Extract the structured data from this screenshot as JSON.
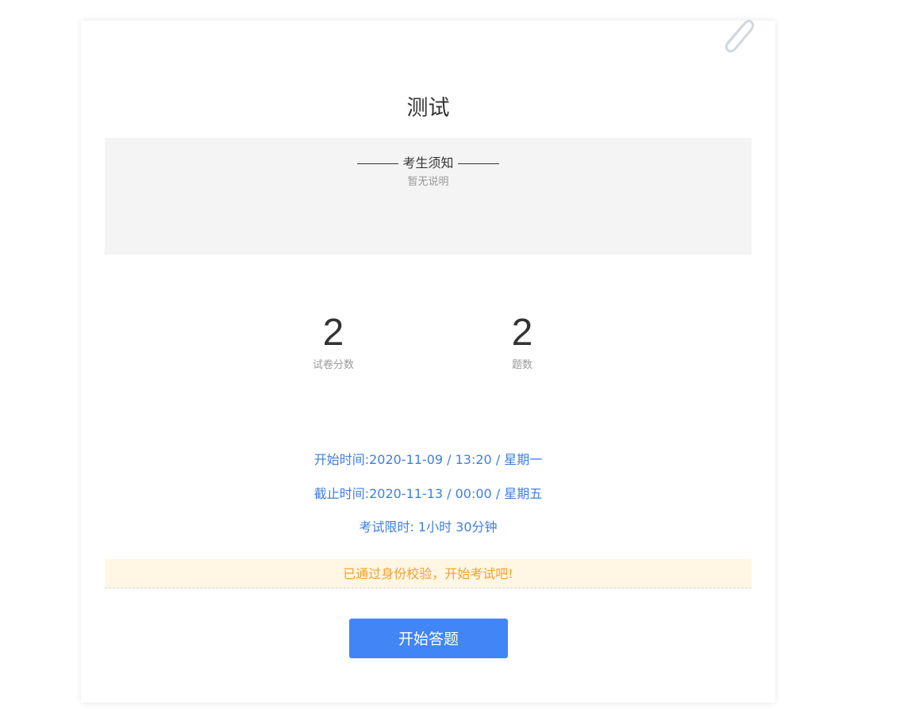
{
  "exam": {
    "title": "测试",
    "notice": {
      "heading": "考生须知",
      "body": "暂无说明"
    },
    "stats": [
      {
        "value": "2",
        "label": "试卷分数"
      },
      {
        "value": "2",
        "label": "题数"
      }
    ],
    "start_time": "开始时间:2020-11-09 / 13:20 / 星期一",
    "end_time": "截止时间:2020-11-13 / 00:00 / 星期五",
    "time_limit": "考试限时: 1小时 30分钟",
    "verification_message": "已通过身份校验，开始考试吧!",
    "start_button_label": "开始答题"
  },
  "icons": {
    "corner": "paperclip-icon"
  },
  "colors": {
    "accent_blue": "#4285f4",
    "info_text": "#3f7fe0",
    "warning_bg": "#fff6e3",
    "warning_text": "#f1a22b",
    "notice_bg": "#f4f4f4"
  }
}
